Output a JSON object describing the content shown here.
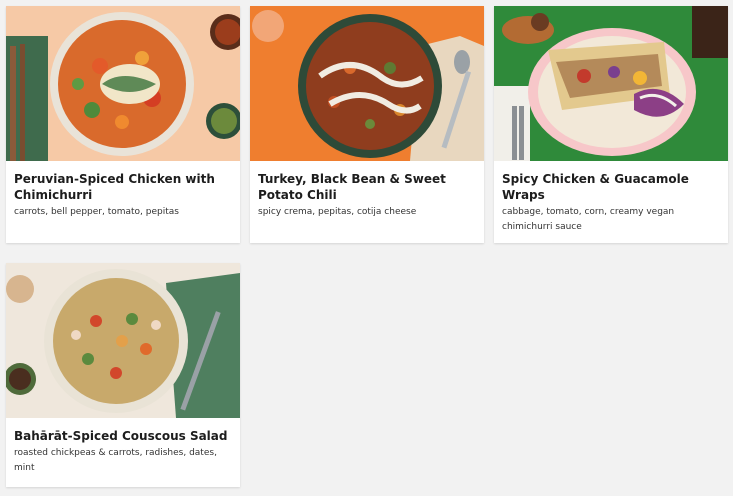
{
  "recipes": [
    {
      "title": "Peruvian-Spiced Chicken with Chimichurri",
      "description": "carrots, bell pepper, tomato, pepitas"
    },
    {
      "title": "Turkey, Black Bean & Sweet Potato Chili",
      "description": "spicy crema, pepitas, cotija cheese"
    },
    {
      "title": "Spicy Chicken & Guacamole Wraps",
      "description": "cabbage, tomato, corn, creamy vegan chimichurri sauce"
    },
    {
      "title": "Bahārāt-Spiced Couscous Salad",
      "description": "roasted chickpeas & carrots, radishes, dates, mint"
    }
  ],
  "colors": {
    "page_background": "#f2f2f2",
    "card_background": "#ffffff",
    "title_text": "#1d1d1d",
    "description_text": "#333333"
  }
}
